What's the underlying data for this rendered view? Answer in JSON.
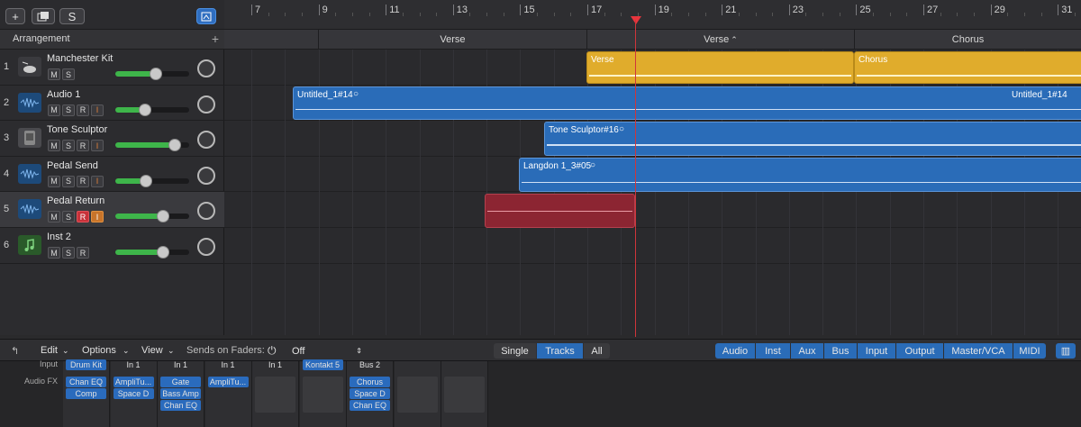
{
  "toolbar": {
    "add_label": "+",
    "s_label": "S"
  },
  "arrangement": {
    "title": "Arrangement",
    "add_label": "+"
  },
  "ruler": {
    "bars": [
      "7",
      "9",
      "11",
      "13",
      "15",
      "17",
      "19",
      "21",
      "23",
      "25",
      "27",
      "29",
      "31"
    ]
  },
  "markers": [
    "Verse",
    "Verse",
    "Chorus"
  ],
  "tracks": [
    {
      "num": "1",
      "name": "Manchester Kit",
      "buttons": [
        "M",
        "S"
      ],
      "fader": 0.55,
      "icon": "drum-kit-icon"
    },
    {
      "num": "2",
      "name": "Audio 1",
      "buttons": [
        "M",
        "S",
        "R",
        "I"
      ],
      "fader": 0.4,
      "icon": "waveform-icon"
    },
    {
      "num": "3",
      "name": "Tone Sculptor",
      "buttons": [
        "M",
        "S",
        "R",
        "I"
      ],
      "fader": 0.8,
      "icon": "amp-icon"
    },
    {
      "num": "4",
      "name": "Pedal Send",
      "buttons": [
        "M",
        "S",
        "R",
        "I"
      ],
      "fader": 0.42,
      "icon": "waveform-icon"
    },
    {
      "num": "5",
      "name": "Pedal Return",
      "buttons": [
        "M",
        "S",
        "R",
        "I"
      ],
      "fader": 0.65,
      "icon": "waveform-icon"
    },
    {
      "num": "6",
      "name": "Inst 2",
      "buttons": [
        "M",
        "S",
        "R"
      ],
      "fader": 0.65,
      "icon": "instrument-icon"
    }
  ],
  "regions": [
    {
      "name": "Verse"
    },
    {
      "name": "Chorus"
    },
    {
      "name": "Untitled_1#14"
    },
    {
      "name": "Untitled_1#14"
    },
    {
      "name": "Tone Sculptor#16"
    },
    {
      "name": "Langdon 1_3#05"
    }
  ],
  "mixer_bar": {
    "edit": "Edit",
    "options": "Options",
    "view": "View",
    "sends_label": "Sends on Faders:",
    "sends_value": "Off",
    "views": [
      "Single",
      "Tracks",
      "All"
    ],
    "filters": [
      "Audio",
      "Inst",
      "Aux",
      "Bus",
      "Input",
      "Output",
      "Master/VCA",
      "MIDI"
    ]
  },
  "mixer": {
    "input_label": "Input",
    "fx_label": "Audio FX",
    "strips": [
      {
        "input": "Drum Kit",
        "fx": [
          "Chan EQ",
          "Comp"
        ]
      },
      {
        "input": "In 1",
        "fx": [
          "AmpliTu...",
          "Space D"
        ]
      },
      {
        "input": "In 1",
        "fx": [
          "Gate",
          "Bass Amp",
          "Chan EQ"
        ]
      },
      {
        "input": "In 1",
        "fx": [
          "AmpliTu..."
        ]
      },
      {
        "input": "In 1",
        "fx": []
      },
      {
        "input": "Kontakt 5",
        "fx": []
      },
      {
        "input": "Bus 2",
        "fx": [
          "Chorus",
          "Space D",
          "Chan EQ"
        ]
      },
      {
        "input": "",
        "fx": []
      },
      {
        "input": "",
        "fx": []
      }
    ]
  }
}
